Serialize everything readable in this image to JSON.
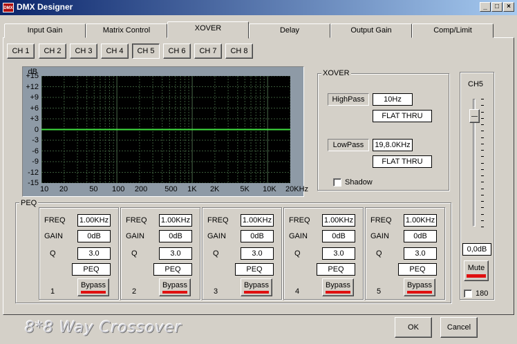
{
  "window": {
    "icon_text": "DMX",
    "title": "DMX Designer",
    "minimize": "_",
    "maximize": "□",
    "close": "×"
  },
  "tabs": [
    "Input Gain",
    "Matrix Control",
    "XOVER",
    "Delay",
    "Output Gain",
    "Comp/Limit"
  ],
  "active_tab": "XOVER",
  "channels": [
    "CH 1",
    "CH 2",
    "CH 3",
    "CH 4",
    "CH 5",
    "CH 6",
    "CH 7",
    "CH 8"
  ],
  "active_channel": "CH 5",
  "graph": {
    "unit": "dB",
    "y_ticks": [
      "+15",
      "+12",
      "+9",
      "+6",
      "+3",
      "0",
      "-3",
      "-6",
      "-9",
      "-12",
      "-15"
    ],
    "x_ticks": [
      "10",
      "20",
      "50",
      "100",
      "200",
      "500",
      "1K",
      "2K",
      "5K",
      "10K",
      "20KHz"
    ],
    "colors": {
      "background": "#000000",
      "grid": "#3a5a3a",
      "curve": "#40e040",
      "frame": "#8e9aa6"
    }
  },
  "chart_data": {
    "type": "line",
    "title": "",
    "xlabel": "",
    "ylabel": "dB",
    "x_scale": "log",
    "xlim": [
      10,
      20000
    ],
    "ylim": [
      -15,
      15
    ],
    "x_tick_labels": [
      "10",
      "20",
      "50",
      "100",
      "200",
      "500",
      "1K",
      "2K",
      "5K",
      "10K",
      "20KHz"
    ],
    "y_tick_labels": [
      "+15",
      "+12",
      "+9",
      "+6",
      "+3",
      "0",
      "-3",
      "-6",
      "-9",
      "-12",
      "-15"
    ],
    "grid": true,
    "series": [
      {
        "x": [
          10,
          20,
          50,
          100,
          200,
          500,
          1000,
          2000,
          5000,
          10000,
          20000
        ],
        "y": [
          0,
          0,
          0,
          0,
          0,
          0,
          0,
          0,
          0,
          0,
          0
        ]
      }
    ]
  },
  "xover": {
    "label": "XOVER",
    "highpass_label": "HighPass",
    "highpass_freq": "10Hz",
    "highpass_type": "FLAT THRU",
    "lowpass_label": "LowPass",
    "lowpass_freq": "19,8.0KHz",
    "lowpass_type": "FLAT THRU",
    "shadow_label": "Shadow",
    "shadow_checked": false
  },
  "peq": {
    "label": "PEQ",
    "freq_label": "FREQ",
    "gain_label": "GAIN",
    "q_label": "Q",
    "bands": [
      {
        "number": "1",
        "freq": "1.00KHz",
        "gain": "0dB",
        "q": "3.0",
        "type": "PEQ",
        "bypass": "Bypass"
      },
      {
        "number": "2",
        "freq": "1.00KHz",
        "gain": "0dB",
        "q": "3.0",
        "type": "PEQ",
        "bypass": "Bypass"
      },
      {
        "number": "3",
        "freq": "1.00KHz",
        "gain": "0dB",
        "q": "3.0",
        "type": "PEQ",
        "bypass": "Bypass"
      },
      {
        "number": "4",
        "freq": "1.00KHz",
        "gain": "0dB",
        "q": "3.0",
        "type": "PEQ",
        "bypass": "Bypass"
      },
      {
        "number": "5",
        "freq": "1.00KHz",
        "gain": "0dB",
        "q": "3.0",
        "type": "PEQ",
        "bypass": "Bypass"
      }
    ]
  },
  "channel_strip": {
    "label": "CH5",
    "gain_value": "0,0dB",
    "slider_level": 0.92,
    "mute_label": "Mute",
    "phase_label": "180",
    "phase_checked": false
  },
  "footer": {
    "caption": "8*8 Way Crossover",
    "ok": "OK",
    "cancel": "Cancel"
  },
  "colors": {
    "indicator_red": "#e01010",
    "title_blue": "#0a246a"
  }
}
